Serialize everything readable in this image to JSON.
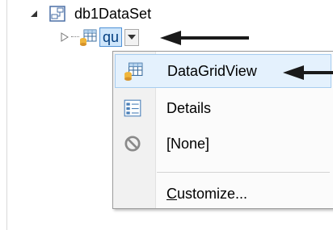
{
  "tree": {
    "dataset_label": "db1DataSet",
    "query_label": "qu"
  },
  "menu": {
    "items": [
      {
        "label": "DataGridView",
        "icon": "datagridview-icon",
        "selected": true
      },
      {
        "label": "Details",
        "icon": "details-icon",
        "selected": false
      },
      {
        "label": "[None]",
        "icon": "none-icon",
        "selected": false
      }
    ],
    "customize": {
      "access_key": "C",
      "rest": "ustomize..."
    }
  },
  "colors": {
    "selection_fill": "#e4f1fd",
    "selection_border": "#a7cdf0",
    "arrow": "#1a1a1a"
  }
}
